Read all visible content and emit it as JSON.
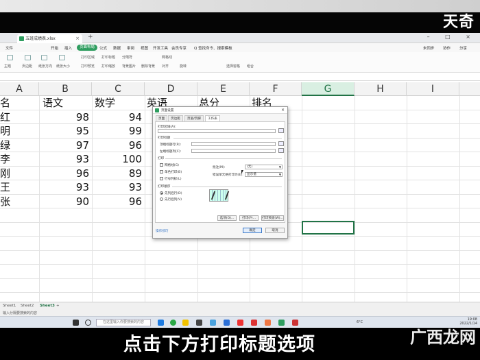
{
  "overlay": {
    "logo": "天奇",
    "subtitle": "点击下方打印标题选项",
    "watermark": "广西龙网"
  },
  "window": {
    "tab_title": "五班成绩表.xlsx",
    "tab_close": "×",
    "tab_plus": "+",
    "controls": "– □ ×"
  },
  "menu": {
    "items": [
      "文件",
      "开始",
      "插入",
      "页面布局",
      "公式",
      "数据",
      "审阅",
      "视图",
      "开发工具",
      "会员专享",
      "Q 查找命令、搜索模板"
    ],
    "active_index": 3,
    "right": [
      "未同步",
      "协作",
      "分享"
    ]
  },
  "ribbon": {
    "items": [
      "主题",
      "页边距",
      "纸张方向",
      "纸张大小",
      "打印区域",
      "打印预览",
      "打印标题",
      "打印缩放",
      "分隔符",
      "背景图片",
      "删除背景",
      "网格线",
      "对齐",
      "旋转",
      "选择窗格",
      "组合"
    ]
  },
  "columns": [
    "A",
    "B",
    "C",
    "D",
    "E",
    "F",
    "G",
    "H",
    "I"
  ],
  "active_column": "G",
  "table": {
    "headers": [
      "名",
      "语文",
      "数学",
      "英语",
      "总分",
      "排名"
    ],
    "rows": [
      {
        "name": "红",
        "chinese": "98",
        "math": "94"
      },
      {
        "name": "明",
        "chinese": "95",
        "math": "99"
      },
      {
        "name": "绿",
        "chinese": "97",
        "math": "96"
      },
      {
        "name": "李",
        "chinese": "93",
        "math": "100"
      },
      {
        "name": "刚",
        "chinese": "96",
        "math": "89"
      },
      {
        "name": "王",
        "chinese": "93",
        "math": "93"
      },
      {
        "name": "张",
        "chinese": "90",
        "math": "96"
      }
    ]
  },
  "sheets": [
    "Sheet1",
    "Sheet2",
    "Sheet3",
    "+"
  ],
  "active_sheet": "Sheet3",
  "status": {
    "left": "输入分隔要搜索的内容"
  },
  "dialog": {
    "title": "页面设置",
    "close": "×",
    "tabs": [
      "页面",
      "页边距",
      "页眉/页脚",
      "工作表"
    ],
    "active_tab": "工作表",
    "print_area_label": "打印区域(A):",
    "print_titles_label": "打印标题",
    "top_rows_label": "顶端标题行(R):",
    "left_cols_label": "左端标题列(C):",
    "print_section": "打印",
    "gridlines": "网格线(G)",
    "single_color": "单色打印(B)",
    "row_col_heads": "行号列标(L)",
    "comments_label": "批注(M):",
    "comments_value": "(无)",
    "errors_label": "错误单元格打印为(E):",
    "errors_value": "显示值",
    "order_section": "打印顺序",
    "down_then_over": "先列后行(D)",
    "over_then_down": "先行后列(V)",
    "btn_print": "打印(P)...",
    "btn_preview": "打印预览(W)...",
    "btn_options": "选项(O)...",
    "help": "操作技巧",
    "ok": "确定",
    "cancel": "取消"
  },
  "taskbar": {
    "search_placeholder": "在这里输入你要搜索的内容",
    "weather": "6°C",
    "time": "19:08",
    "date": "2022/1/14"
  }
}
